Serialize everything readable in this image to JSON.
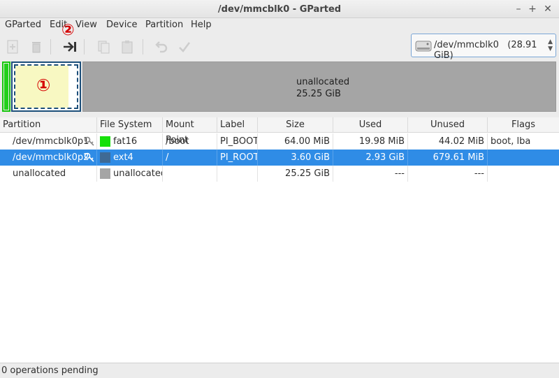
{
  "window": {
    "title": "/dev/mmcblk0 - GParted",
    "controls": {
      "close": "✕",
      "maximize": "+",
      "minimize": "–"
    }
  },
  "menu": [
    "GParted",
    "Edit",
    "View",
    "Device",
    "Partition",
    "Help"
  ],
  "toolbar": {
    "buttons": [
      "new-icon",
      "delete-icon",
      "resize-move-icon",
      "copy-icon",
      "paste-icon",
      "undo-icon",
      "apply-icon"
    ],
    "enabled_button": "resize-move-icon"
  },
  "device_selector": {
    "device": "/dev/mmcblk0",
    "size": "(28.91 GiB)"
  },
  "annotations": {
    "one": "①",
    "two": "②",
    "color": "#d50000"
  },
  "disk_map": {
    "unallocated_label": "unallocated",
    "unallocated_size": "25.25 GiB"
  },
  "table": {
    "columns": [
      "Partition",
      "File System",
      "Mount Point",
      "Label",
      "Size",
      "Used",
      "Unused",
      "Flags"
    ],
    "rows": [
      {
        "partition": "/dev/mmcblk0p1",
        "fs": "fat16",
        "fs_color": "#16e00a",
        "mount": "/boot",
        "label": "PI_BOOT",
        "size": "64.00 MiB",
        "used": "19.98 MiB",
        "unused": "44.02 MiB",
        "flags": "boot, lba",
        "key_icon": "key-icon"
      },
      {
        "partition": "/dev/mmcblk0p2",
        "fs": "ext4",
        "fs_color": "#3f6a95",
        "mount": "/",
        "label": "PI_ROOT",
        "size": "3.60 GiB",
        "used": "2.93 GiB",
        "unused": "679.61 MiB",
        "flags": "",
        "key_icon": "key-icon"
      },
      {
        "partition": "unallocated",
        "fs": "unallocated",
        "fs_color": "#a5a5a5",
        "mount": "",
        "label": "",
        "size": "25.25 GiB",
        "used": "---",
        "unused": "---",
        "flags": "",
        "key_icon": ""
      }
    ]
  },
  "status": {
    "text": "0 operations pending"
  }
}
